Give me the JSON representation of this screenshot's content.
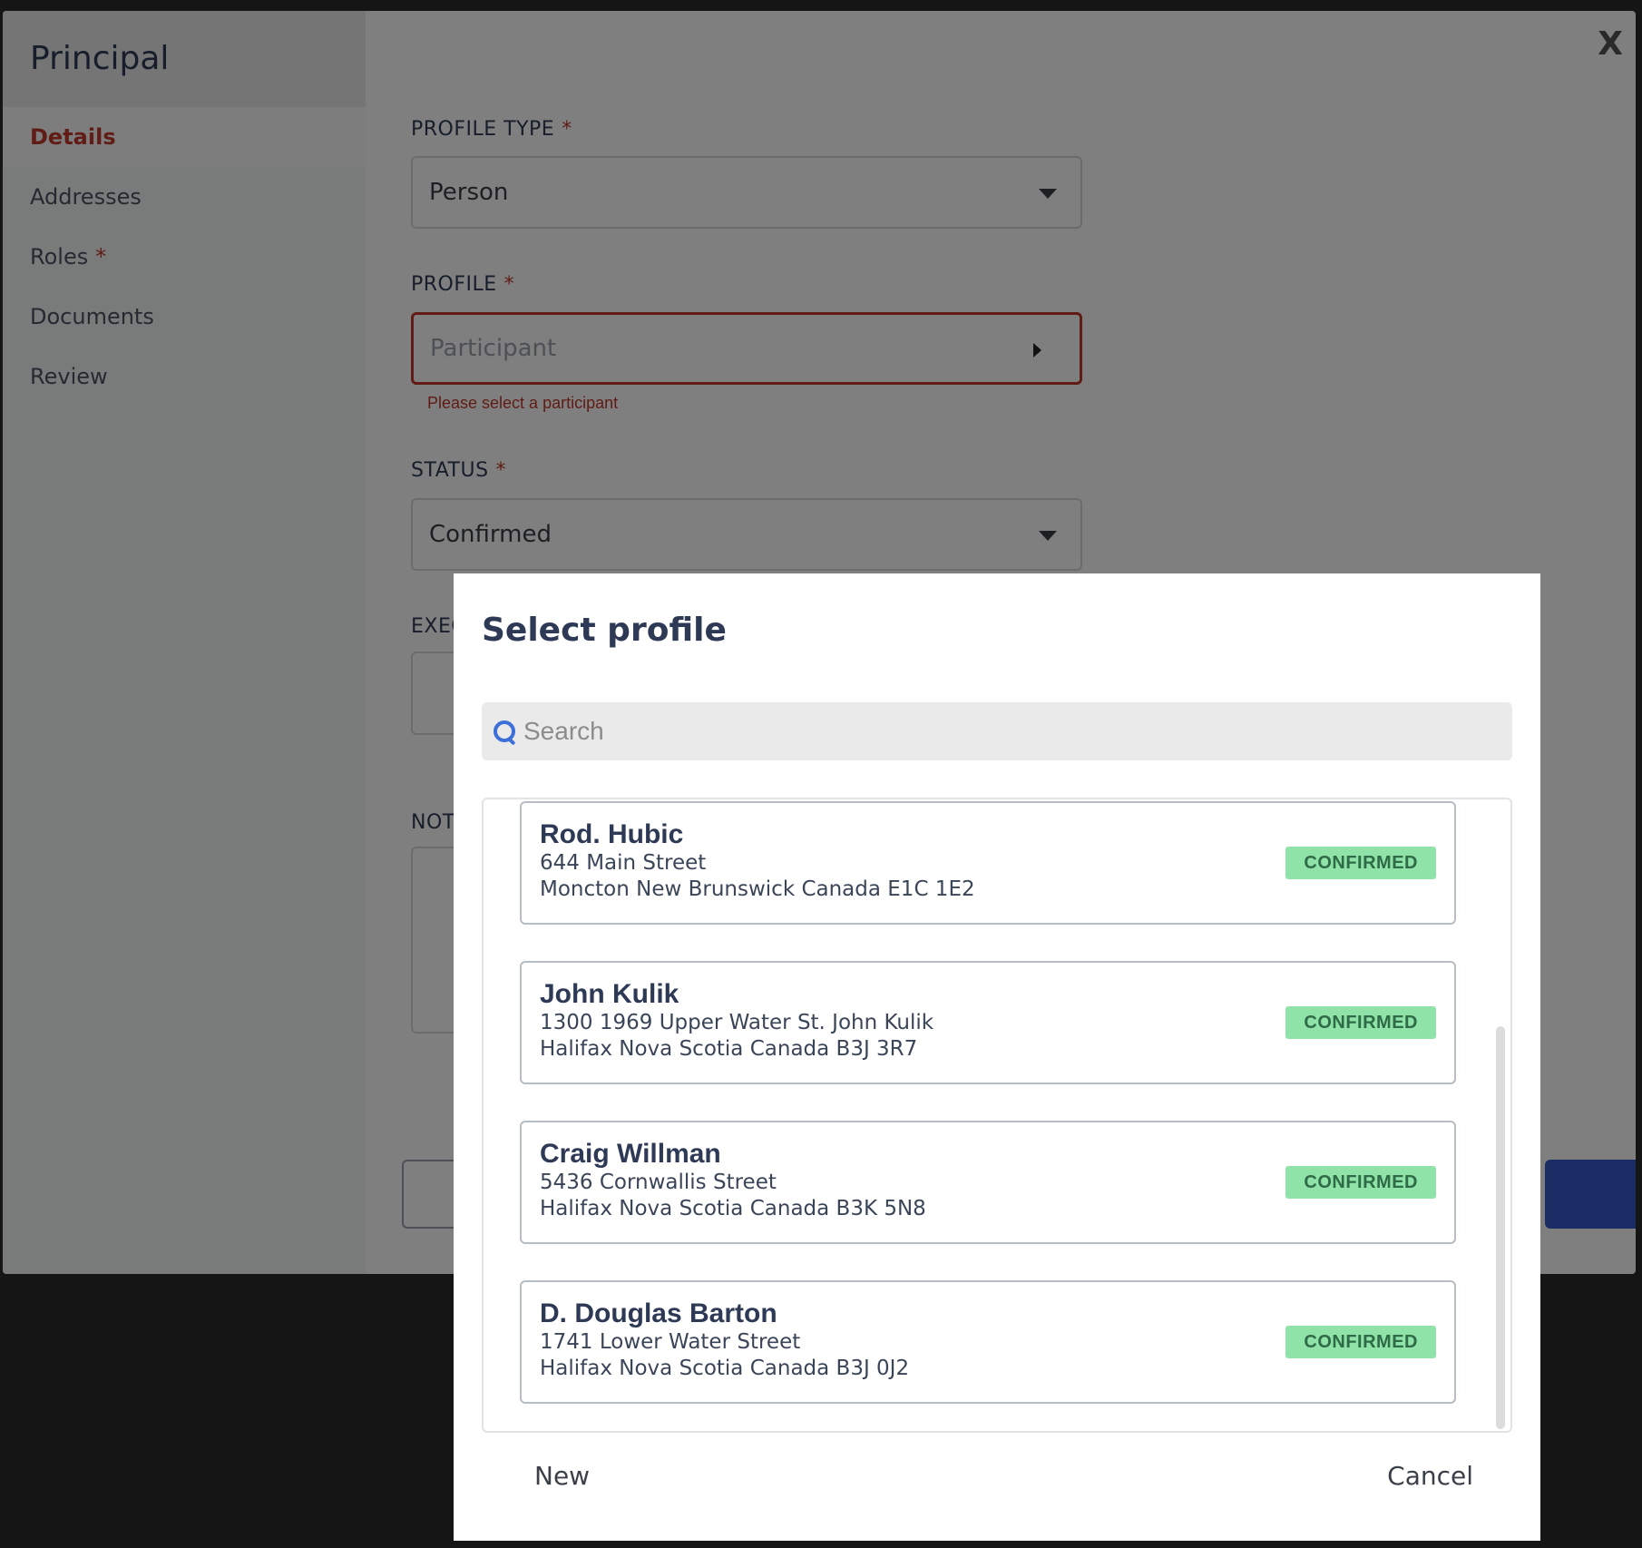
{
  "principal": {
    "title": "Principal",
    "close_label": "X",
    "nav": [
      {
        "label": "Details",
        "active": true,
        "required": false
      },
      {
        "label": "Addresses",
        "active": false,
        "required": false
      },
      {
        "label": "Roles",
        "active": false,
        "required": true
      },
      {
        "label": "Documents",
        "active": false,
        "required": false
      },
      {
        "label": "Review",
        "active": false,
        "required": false
      }
    ],
    "required_marker": "*",
    "fields": {
      "profile_type": {
        "label": "PROFILE TYPE",
        "value": "Person"
      },
      "profile": {
        "label": "PROFILE",
        "placeholder": "Participant",
        "error": "Please select a participant"
      },
      "status": {
        "label": "STATUS",
        "value": "Confirmed"
      },
      "exec_label_partial": "EXEC",
      "notes_label_partial": "NOT"
    }
  },
  "select_profile": {
    "title": "Select profile",
    "search": {
      "placeholder": "Search"
    },
    "profiles": [
      {
        "name": "Rod. Hubic",
        "address1": "644 Main Street",
        "address2": "Moncton New Brunswick Canada E1C 1E2",
        "status": "CONFIRMED"
      },
      {
        "name": "John Kulik",
        "address1": "1300 1969 Upper Water St. John Kulik",
        "address2": "Halifax Nova Scotia Canada B3J 3R7",
        "status": "CONFIRMED"
      },
      {
        "name": "Craig Willman",
        "address1": "5436 Cornwallis Street",
        "address2": "Halifax Nova Scotia Canada B3K 5N8",
        "status": "CONFIRMED"
      },
      {
        "name": "D. Douglas Barton",
        "address1": "1741 Lower Water Street",
        "address2": "Halifax Nova Scotia Canada B3J 0J2",
        "status": "CONFIRMED"
      }
    ],
    "new_label": "New",
    "cancel_label": "Cancel"
  },
  "colors": {
    "accent_red": "#c0392b",
    "badge_green": "#8fe3a8",
    "primary_blue": "#3358c7",
    "search_icon_blue": "#3d6fd8"
  }
}
